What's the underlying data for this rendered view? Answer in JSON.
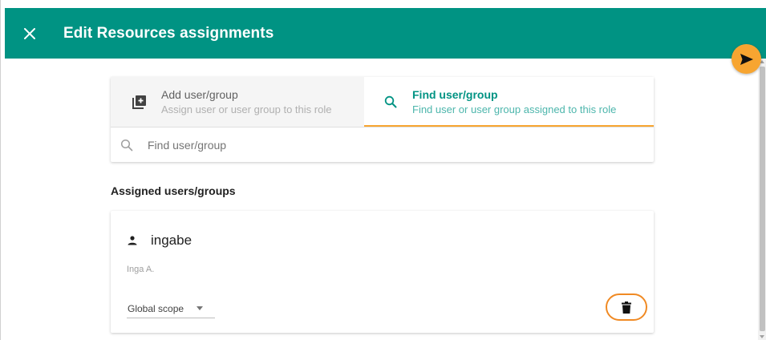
{
  "dialog": {
    "title": "Edit Resources assignments"
  },
  "tabs": {
    "add": {
      "label": "Add user/group",
      "subtitle": "Assign user or user group to this role"
    },
    "find": {
      "label": "Find user/group",
      "subtitle": "Find user or user group assigned to this role"
    }
  },
  "search": {
    "placeholder": "Find user/group",
    "value": ""
  },
  "assigned": {
    "section_title": "Assigned users/groups",
    "items": [
      {
        "username": "ingabe",
        "full_name": "Inga A.",
        "scope": "Global scope"
      }
    ]
  },
  "colors": {
    "header": "#009383",
    "accent": "#f7a531",
    "highlight": "#f08a24"
  },
  "icons": {
    "close": "close-icon",
    "send": "send-icon",
    "add": "add-box-icon",
    "find": "search-icon",
    "search": "search-icon",
    "person": "person-icon",
    "delete": "trash-icon"
  }
}
